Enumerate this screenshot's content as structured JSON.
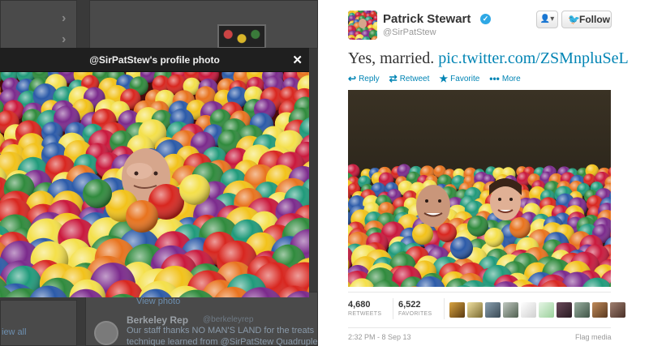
{
  "background": {
    "rep_name": "Berkeley Rep",
    "rep_handle": "@berkeleyrep",
    "rep_text_1": "Our staff thanks NO MAN'S LAND for the treats",
    "rep_text_2": "technique learned from @SirPatStew Quadruple",
    "view_photo": "View photo",
    "view_all": "iew all"
  },
  "overlay": {
    "title": "@SirPatStew's profile photo",
    "close": "✕"
  },
  "tweet": {
    "author_name": "Patrick Stewart",
    "author_handle": "@SirPatStew",
    "follow_label": "Follow",
    "text": "Yes, married. ",
    "link": "pic.twitter.com/ZSMnpluSeL",
    "actions": {
      "reply": "Reply",
      "retweet": "Retweet",
      "favorite": "Favorite",
      "more": "More"
    },
    "stats": {
      "retweets_count": "4,680",
      "retweets_label": "RETWEETS",
      "favorites_count": "6,522",
      "favorites_label": "FAVORITES"
    },
    "timestamp": "2:32 PM - 8 Sep 13",
    "flag_media": "Flag media"
  },
  "colors": {
    "link": "#0084b4",
    "verified": "#2ea8e5"
  }
}
